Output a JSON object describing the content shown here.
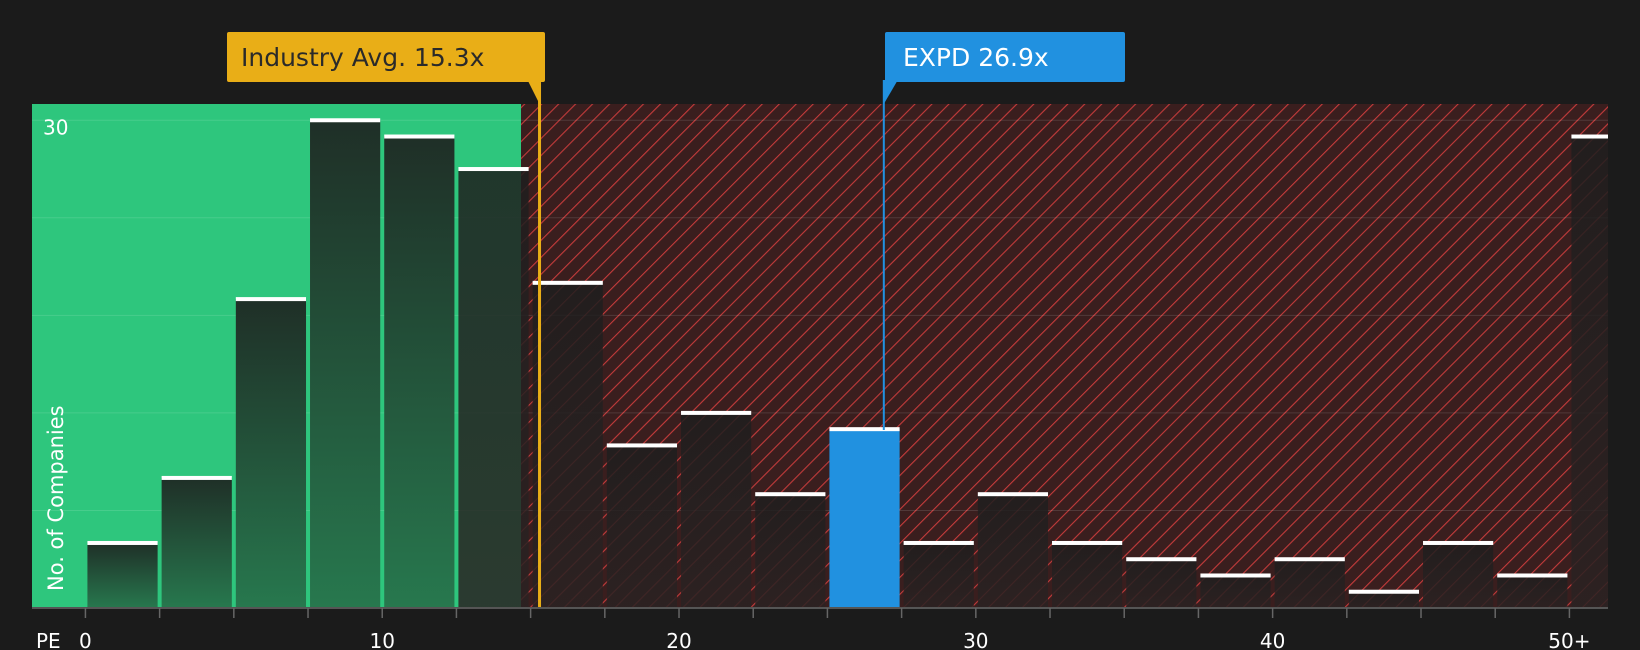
{
  "chart_data": {
    "type": "bar",
    "x_axis_label": "PE",
    "y_axis_label": "No. of Companies",
    "x_tick_labels": [
      "0",
      "10",
      "20",
      "30",
      "40",
      "50+"
    ],
    "y_tick_labels": [
      "30"
    ],
    "bin_width": 2.5,
    "bins": [
      {
        "from": 0,
        "to": 2.5,
        "count": 4
      },
      {
        "from": 2.5,
        "to": 5,
        "count": 8
      },
      {
        "from": 5,
        "to": 7.5,
        "count": 19
      },
      {
        "from": 7.5,
        "to": 10,
        "count": 30
      },
      {
        "from": 10,
        "to": 12.5,
        "count": 29
      },
      {
        "from": 12.5,
        "to": 15,
        "count": 27
      },
      {
        "from": 15,
        "to": 17.5,
        "count": 20
      },
      {
        "from": 17.5,
        "to": 20,
        "count": 10
      },
      {
        "from": 20,
        "to": 22.5,
        "count": 12
      },
      {
        "from": 22.5,
        "to": 25,
        "count": 7
      },
      {
        "from": 25,
        "to": 27.5,
        "count": 11
      },
      {
        "from": 27.5,
        "to": 30,
        "count": 4
      },
      {
        "from": 30,
        "to": 32.5,
        "count": 7
      },
      {
        "from": 32.5,
        "to": 35,
        "count": 4
      },
      {
        "from": 35,
        "to": 37.5,
        "count": 3
      },
      {
        "from": 37.5,
        "to": 40,
        "count": 2
      },
      {
        "from": 40,
        "to": 42.5,
        "count": 3
      },
      {
        "from": 42.5,
        "to": 45,
        "count": 1
      },
      {
        "from": 45,
        "to": 47.5,
        "count": 4
      },
      {
        "from": 47.5,
        "to": 50,
        "count": 2
      },
      {
        "from": 50,
        "to": null,
        "count": 29
      }
    ],
    "highlighted_bin": 10,
    "ylim": [
      0,
      31
    ],
    "xlim": [
      -1.8,
      51.3
    ],
    "industry_avg": {
      "label": "Industry Avg. 15.3x",
      "value": 15.3
    },
    "company": {
      "label": "EXPD 26.9x",
      "value": 26.9
    },
    "grid": true,
    "colors": {
      "background": "#1b1b1b",
      "fair_zone": "#2ec67d",
      "overvalued_zone": "#3a1e1e",
      "hatch": "#c43b3b",
      "bar_dark": "#25362d",
      "highlight": "#2191e0",
      "industry": "#e9ae17",
      "cap": "#ffffff"
    }
  }
}
